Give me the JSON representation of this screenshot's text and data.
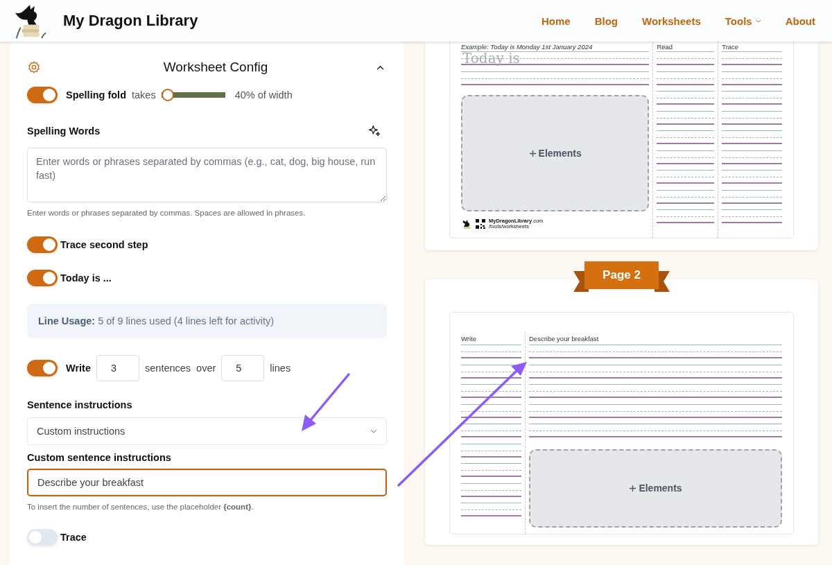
{
  "header": {
    "title": "My Dragon Library",
    "nav": [
      {
        "label": "Home",
        "kind": "link"
      },
      {
        "label": "Blog",
        "kind": "link"
      },
      {
        "label": "Worksheets",
        "kind": "link"
      },
      {
        "label": "Tools",
        "kind": "menu"
      },
      {
        "label": "About",
        "kind": "link"
      }
    ]
  },
  "config": {
    "title": "Worksheet Config",
    "expanded": true,
    "spelling_fold": {
      "on": true,
      "label": "Spelling fold",
      "takes": "takes",
      "level": 0,
      "reading": "40% of width"
    },
    "spelling_words": {
      "label": "Spelling Words",
      "placeholder": "Enter words or phrases separated by commas (e.g., cat, dog, big house, run fast)",
      "hint": "Enter words or phrases separated by commas. Spaces are allowed in phrases."
    },
    "toggles": [
      {
        "label": "Trace second step",
        "on": true
      },
      {
        "label": "Today is ...",
        "on": true
      }
    ],
    "line_usage": "**Line Usage:** 5 of 9 lines used (4 lines left for activity)",
    "write": {
      "on": true,
      "label": "Write",
      "sentences": "3",
      "sentences_label": "sentences",
      "over": "over",
      "lines": "5",
      "lines_label": "lines"
    },
    "sentence_instructions": {
      "label": "Sentence instructions",
      "value": "Custom instructions"
    },
    "custom_instructions": {
      "label": "Custom sentence instructions",
      "value": "Describe your breakfast",
      "focused": true,
      "hint": "To insert the number of sentences, use the placeholder **{count}**."
    },
    "trace": {
      "label": "Trace",
      "on": false
    }
  },
  "pages": [
    {
      "kind": "today",
      "example": "Example: Today is Monday 1st January 2024",
      "trace_text": "Today is",
      "columns": [
        "Read",
        "Trace"
      ],
      "elements": "Elements",
      "footer_site": "**MyDragonLibrary**.com",
      "footer_path": "/tools/worksheets"
    },
    {
      "kind": "sentences",
      "ribbon": "Page 2",
      "side_column": "Write",
      "heading": "Describe your breakfast",
      "elements": "Elements"
    }
  ]
}
